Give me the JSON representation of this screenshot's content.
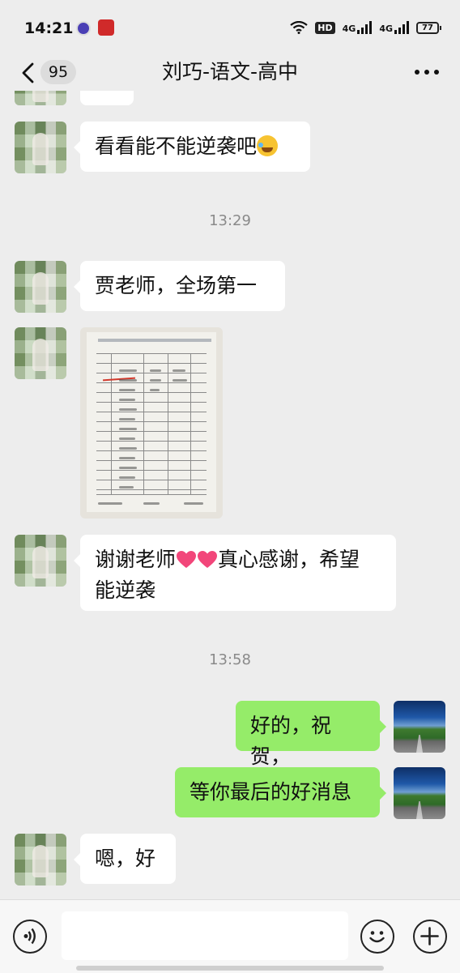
{
  "status_bar": {
    "time": "14:21",
    "battery": "77",
    "hd_label": "HD",
    "network_1": "4G",
    "network_2": "4G"
  },
  "header": {
    "back_count": "95",
    "title": "刘巧-语文-高中"
  },
  "messages": {
    "m1_text": "看看能不能逆袭吧",
    "m1_emoji": "cry-laugh-emoji",
    "time_1": "13:29",
    "m2_text": "贾老师，全场第一",
    "m3_image": "exam-score-sheet-photo",
    "m4_line1_a": "谢谢老师",
    "m4_line1_b": "真心感谢，希望",
    "m4_line2": "能逆袭",
    "time_2": "13:58",
    "m5_text": "好的，祝贺，",
    "m6_text": "等你最后的好消息",
    "m7_text": "嗯，好"
  },
  "colors": {
    "background": "#ededed",
    "self_bubble": "#95ec69",
    "other_bubble": "#ffffff",
    "timestamp": "#8a8a8a"
  },
  "icons": {
    "back": "chevron-left-icon",
    "more": "more-icon",
    "voice": "voice-icon",
    "emoji": "emoji-icon",
    "plus": "plus-icon"
  }
}
